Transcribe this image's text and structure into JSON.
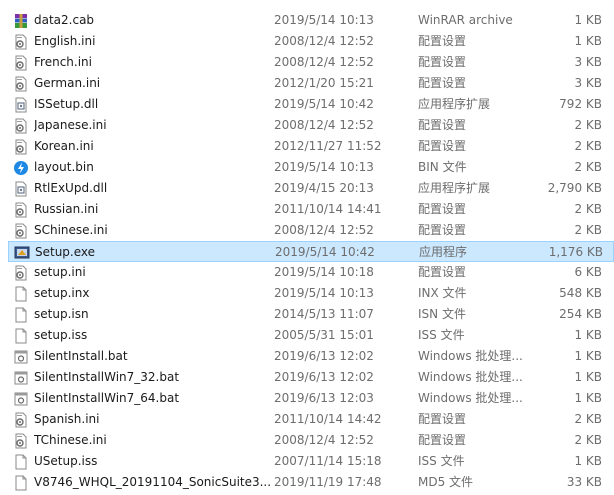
{
  "colors": {
    "selected_row_bg": "#cce8ff",
    "selected_row_border": "#99d1ff",
    "secondary_text": "#6d6d6d",
    "primary_text": "#1a1a1a"
  },
  "files": [
    {
      "name": "data2.cab",
      "date": "2019/5/14 10:13",
      "type": "WinRAR archive",
      "size": "1 KB",
      "icon": "winrar-archive-icon"
    },
    {
      "name": "English.ini",
      "date": "2008/12/4 12:52",
      "type": "配置设置",
      "size": "1 KB",
      "icon": "config-settings-icon"
    },
    {
      "name": "French.ini",
      "date": "2008/12/4 12:52",
      "type": "配置设置",
      "size": "3 KB",
      "icon": "config-settings-icon"
    },
    {
      "name": "German.ini",
      "date": "2012/1/20 15:21",
      "type": "配置设置",
      "size": "3 KB",
      "icon": "config-settings-icon"
    },
    {
      "name": "ISSetup.dll",
      "date": "2019/5/14 10:42",
      "type": "应用程序扩展",
      "size": "792 KB",
      "icon": "dll-extension-icon"
    },
    {
      "name": "Japanese.ini",
      "date": "2008/12/4 12:52",
      "type": "配置设置",
      "size": "2 KB",
      "icon": "config-settings-icon"
    },
    {
      "name": "Korean.ini",
      "date": "2012/11/27 11:52",
      "type": "配置设置",
      "size": "2 KB",
      "icon": "config-settings-icon"
    },
    {
      "name": "layout.bin",
      "date": "2019/5/14 10:13",
      "type": "BIN 文件",
      "size": "2 KB",
      "icon": "bin-file-icon"
    },
    {
      "name": "RtlExUpd.dll",
      "date": "2019/4/15 20:13",
      "type": "应用程序扩展",
      "size": "2,790 KB",
      "icon": "dll-extension-icon"
    },
    {
      "name": "Russian.ini",
      "date": "2011/10/14 14:41",
      "type": "配置设置",
      "size": "2 KB",
      "icon": "config-settings-icon"
    },
    {
      "name": "SChinese.ini",
      "date": "2008/12/4 12:52",
      "type": "配置设置",
      "size": "2 KB",
      "icon": "config-settings-icon"
    },
    {
      "name": "Setup.exe",
      "date": "2019/5/14 10:42",
      "type": "应用程序",
      "size": "1,176 KB",
      "icon": "setup-application-icon",
      "selected": true
    },
    {
      "name": "setup.ini",
      "date": "2019/5/14 10:18",
      "type": "配置设置",
      "size": "6 KB",
      "icon": "config-settings-icon"
    },
    {
      "name": "setup.inx",
      "date": "2019/5/14 10:13",
      "type": "INX 文件",
      "size": "548 KB",
      "icon": "blank-file-icon"
    },
    {
      "name": "setup.isn",
      "date": "2014/5/13 11:07",
      "type": "ISN 文件",
      "size": "254 KB",
      "icon": "blank-file-icon"
    },
    {
      "name": "setup.iss",
      "date": "2005/5/31 15:01",
      "type": "ISS 文件",
      "size": "1 KB",
      "icon": "blank-file-icon"
    },
    {
      "name": "SilentInstall.bat",
      "date": "2019/6/13 12:02",
      "type": "Windows 批处理...",
      "size": "1 KB",
      "icon": "batch-file-icon"
    },
    {
      "name": "SilentInstallWin7_32.bat",
      "date": "2019/6/13 12:02",
      "type": "Windows 批处理...",
      "size": "1 KB",
      "icon": "batch-file-icon"
    },
    {
      "name": "SilentInstallWin7_64.bat",
      "date": "2019/6/13 12:03",
      "type": "Windows 批处理...",
      "size": "1 KB",
      "icon": "batch-file-icon"
    },
    {
      "name": "Spanish.ini",
      "date": "2011/10/14 14:42",
      "type": "配置设置",
      "size": "2 KB",
      "icon": "config-settings-icon"
    },
    {
      "name": "TChinese.ini",
      "date": "2008/12/4 12:52",
      "type": "配置设置",
      "size": "2 KB",
      "icon": "config-settings-icon"
    },
    {
      "name": "USetup.iss",
      "date": "2007/11/14 15:18",
      "type": "ISS 文件",
      "size": "1 KB",
      "icon": "blank-file-icon"
    },
    {
      "name": "V8746_WHQL_20191104_SonicSuite3....",
      "date": "2019/11/19 17:48",
      "type": "MD5 文件",
      "size": "33 KB",
      "icon": "blank-file-icon"
    }
  ]
}
